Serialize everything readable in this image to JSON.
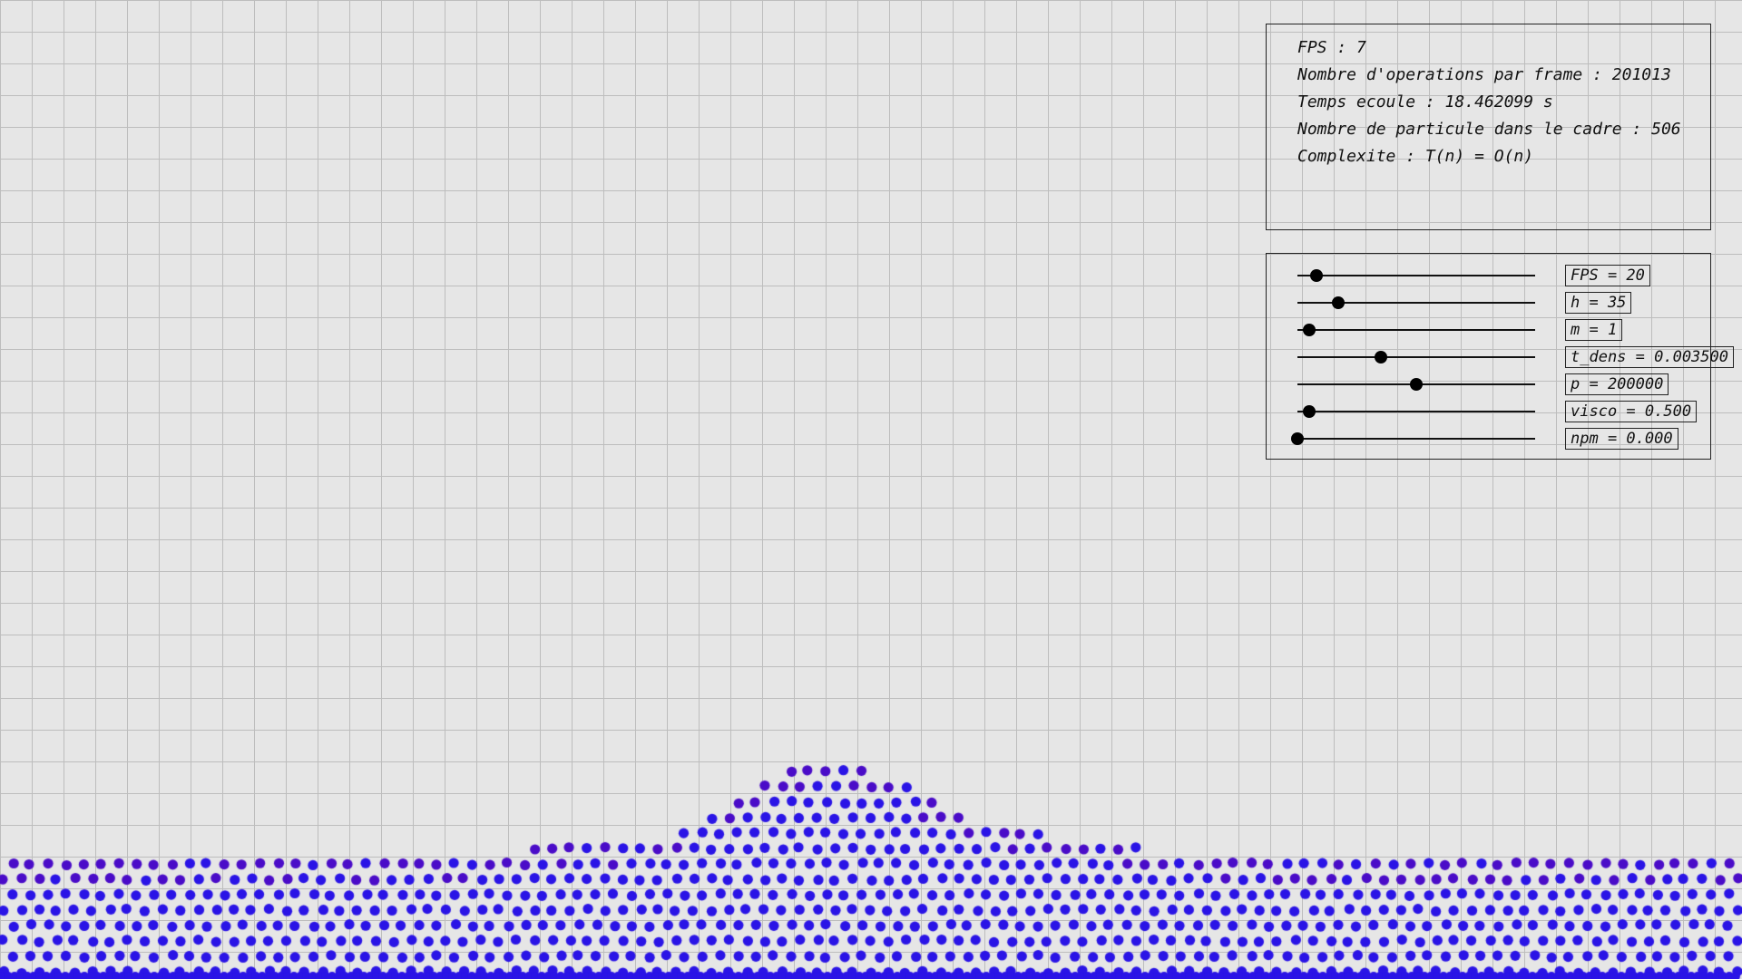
{
  "stats": {
    "fps": "FPS : 7",
    "operations": "Nombre d'operations par frame : 201013",
    "elapsed": "Temps ecoule : 18.462099 s",
    "particle_count": "Nombre de particule dans le cadre : 506",
    "complexity": "Complexite : T(n) = O(n)"
  },
  "controls": {
    "sliders": [
      {
        "label": "FPS = 20",
        "level": 0.08
      },
      {
        "label": "h = 35",
        "level": 0.17
      },
      {
        "label": "m = 1",
        "level": 0.05
      },
      {
        "label": "t_dens = 0.003500",
        "level": 0.35
      },
      {
        "label": "p = 200000",
        "level": 0.5
      },
      {
        "label": "visco = 0.500",
        "level": 0.05
      },
      {
        "label": "npm = 0.000",
        "level": 0.0
      }
    ]
  },
  "colors": {
    "background": "#e6e6e6",
    "grid": "#bdbdbd",
    "particle_primary": "#2a14e6",
    "particle_secondary": "#4a0cc8",
    "knob": "#000000"
  }
}
